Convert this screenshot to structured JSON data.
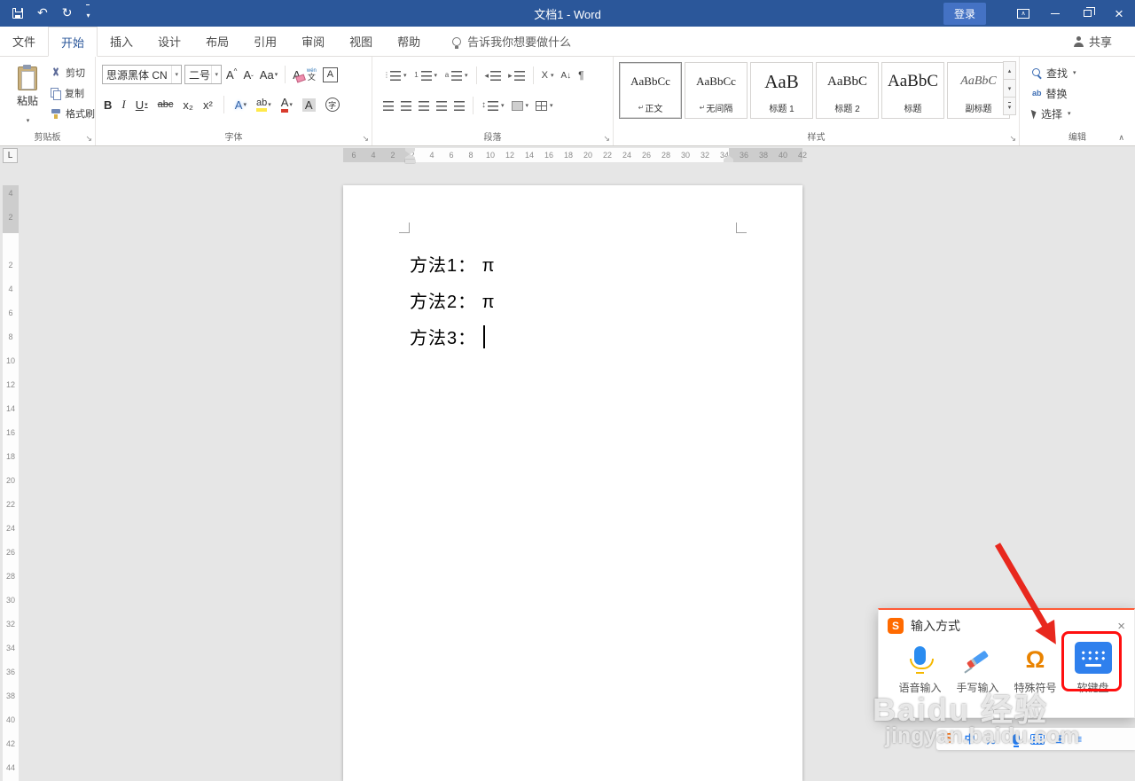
{
  "titlebar": {
    "title": "文档1 - Word",
    "signin": "登录"
  },
  "tabs": {
    "file": "文件",
    "home": "开始",
    "insert": "插入",
    "design": "设计",
    "layout": "布局",
    "references": "引用",
    "review": "审阅",
    "view": "视图",
    "help": "帮助"
  },
  "tellme": "告诉我你想要做什么",
  "share": "共享",
  "ribbon": {
    "clipboard": {
      "group": "剪贴板",
      "paste": "粘贴",
      "cut": "剪切",
      "copy": "复制",
      "format_painter": "格式刷"
    },
    "font": {
      "group": "字体",
      "name": "思源黑体 CN",
      "size": "二号",
      "grow": "A",
      "shrink": "A",
      "case": "Aa",
      "clear": "A",
      "pinyin_top": "wén",
      "pinyin_bottom": "文",
      "char_border": "A",
      "bold": "B",
      "italic": "I",
      "underline": "U",
      "strike": "abc",
      "subscript": "x₂",
      "superscript": "x²",
      "effects": "A",
      "highlight": "ab",
      "color": "A",
      "shading": "A",
      "enclose": "字"
    },
    "paragraph": {
      "group": "段落",
      "sort": "A↓",
      "pilcrow": "¶",
      "cn_layout": "X"
    },
    "styles": {
      "group": "样式",
      "s1": {
        "preview": "AaBbCc",
        "marker": "↵",
        "name": "正文"
      },
      "s2": {
        "preview": "AaBbCc",
        "marker": "↵",
        "name": "无间隔"
      },
      "s3": {
        "preview": "AaB",
        "name": "标题 1"
      },
      "s4": {
        "preview": "AaBbC",
        "name": "标题 2"
      },
      "s5": {
        "preview": "AaBbC",
        "name": "标题"
      },
      "s6": {
        "preview": "AaBbC",
        "name": "副标题"
      }
    },
    "editing": {
      "group": "编辑",
      "find": "查找",
      "replace": "替换",
      "replace_icon": "ab",
      "select": "选择"
    }
  },
  "ruler": {
    "h": [
      "6",
      "4",
      "2",
      "2",
      "4",
      "6",
      "8",
      "10",
      "12",
      "14",
      "16",
      "18",
      "20",
      "22",
      "24",
      "26",
      "28",
      "30",
      "32",
      "34",
      "36",
      "38",
      "40",
      "42"
    ],
    "v": [
      "4",
      "2",
      "",
      "2",
      "4",
      "6",
      "8",
      "10",
      "12",
      "14",
      "16",
      "18",
      "20",
      "22",
      "24",
      "26",
      "28",
      "30",
      "32",
      "34",
      "36",
      "38",
      "40",
      "42",
      "44"
    ]
  },
  "document": {
    "line1": "方法1： π",
    "line2": "方法2： π",
    "line3": "方法3："
  },
  "ime": {
    "title": "输入方式",
    "voice": "语音输入",
    "handwriting": "手写输入",
    "symbols": "特殊符号",
    "symbols_glyph": "Ω",
    "keyboard": "软键盘"
  },
  "sogou_bar": {
    "logo": "S",
    "mode": "中",
    "punct": "，。"
  },
  "watermark": {
    "line1": "Baidu 经验",
    "line2": "jingyan.baidu.com"
  }
}
